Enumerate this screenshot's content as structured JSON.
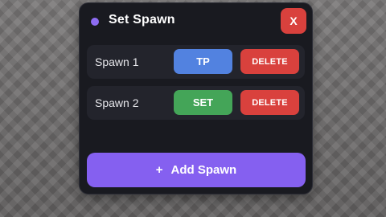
{
  "panel": {
    "title": "Set Spawn",
    "close_label": "X"
  },
  "spawns": [
    {
      "name": "Spawn 1",
      "action_label": "TP",
      "delete_label": "DELETE"
    },
    {
      "name": "Spawn 2",
      "action_label": "SET",
      "delete_label": "DELETE"
    }
  ],
  "add_button": {
    "icon": "+",
    "label": "Add Spawn"
  },
  "colors": {
    "accent": "#8560f0",
    "tp": "#5282e0",
    "set": "#44a558",
    "danger": "#d9413d",
    "panel_bg": "#191a20",
    "row_bg": "#23242c"
  }
}
